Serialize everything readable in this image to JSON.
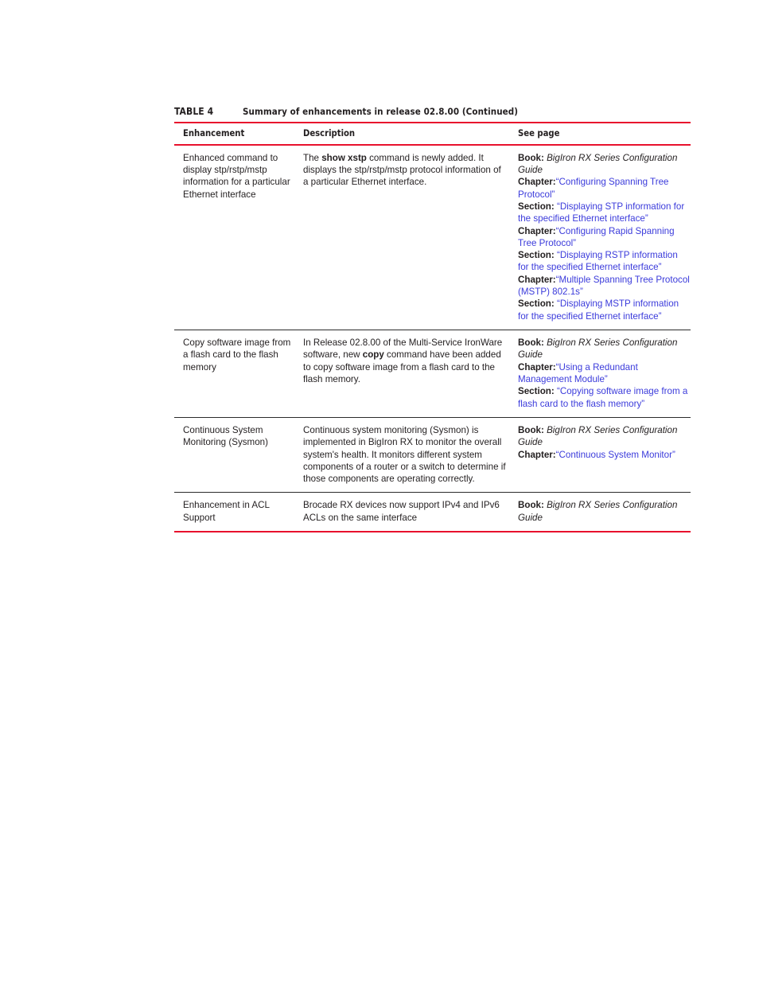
{
  "caption": {
    "label": "TABLE 4",
    "title": "Summary of enhancements in release 02.8.00 (Continued)"
  },
  "colors": {
    "rule_red": "#e8112d",
    "rule_dark": "#2b2b2b",
    "link_blue": "#3b3bdb",
    "text": "#231f20"
  },
  "headers": {
    "enhancement": "Enhancement",
    "description": "Description",
    "see_page": "See page"
  },
  "rows": [
    {
      "enhancement": "Enhanced command to display stp/rstp/mstp information for a particular Ethernet interface",
      "description": {
        "pre": "The ",
        "bold": "show xstp",
        "post": " command is newly added. It displays the stp/rstp/mstp protocol information of a particular Ethernet interface."
      },
      "see_page": [
        {
          "label": "Book:",
          "sep": " ",
          "value": "BigIron RX Series Configuration Guide",
          "style": "italic"
        },
        {
          "label": "Chapter:",
          "sep": "",
          "value": "“Configuring Spanning Tree Protocol”",
          "style": "link"
        },
        {
          "label": "Section:",
          "sep": " ",
          "value": "“Displaying STP information for the specified Ethernet interface”",
          "style": "link"
        },
        {
          "label": "Chapter:",
          "sep": "",
          "value": "“Configuring Rapid Spanning Tree Protocol”",
          "style": "link"
        },
        {
          "label": "Section:",
          "sep": " ",
          "value": "“Displaying RSTP information for the specified Ethernet interface”",
          "style": "link"
        },
        {
          "label": "Chapter:",
          "sep": "",
          "value": "“Multiple Spanning Tree Protocol (MSTP) 802.1s”",
          "style": "link"
        },
        {
          "label": "Section:",
          "sep": " ",
          "value": "“Displaying MSTP information for the specified Ethernet interface”",
          "style": "link"
        }
      ]
    },
    {
      "enhancement": "Copy software image from a flash card to the flash memory",
      "description": {
        "pre": "In Release 02.8.00 of the Multi-Service IronWare software, new ",
        "bold": "copy",
        "post": " command have been added to copy software image from a flash card to the flash memory."
      },
      "see_page": [
        {
          "label": "Book:",
          "sep": " ",
          "value": "BigIron RX Series Configuration Guide",
          "style": "italic"
        },
        {
          "label": "Chapter:",
          "sep": "",
          "value": "“Using a Redundant Management Module”",
          "style": "link"
        },
        {
          "label": "Section:",
          "sep": " ",
          "value": "“Copying software image from a flash card to the flash memory”",
          "style": "link"
        }
      ]
    },
    {
      "enhancement": "Continuous System Monitoring (Sysmon)",
      "description": {
        "pre": "Continuous system monitoring (Sysmon) is implemented in BigIron RX to monitor the overall system's health. It monitors different system components of a router or a switch to determine if those components are operating correctly.",
        "bold": "",
        "post": ""
      },
      "see_page": [
        {
          "label": "Book:",
          "sep": " ",
          "value": "BigIron RX Series Configuration Guide",
          "style": "italic"
        },
        {
          "label": "Chapter:",
          "sep": "",
          "value": "“Continuous System Monitor”",
          "style": "link"
        }
      ]
    },
    {
      "enhancement": "Enhancement in ACL Support",
      "description": {
        "pre": "Brocade RX devices now support IPv4 and IPv6 ACLs on the same interface",
        "bold": "",
        "post": ""
      },
      "see_page": [
        {
          "label": "Book:",
          "sep": " ",
          "value": "BigIron RX Series Configuration Guide",
          "style": "italic"
        }
      ]
    }
  ]
}
